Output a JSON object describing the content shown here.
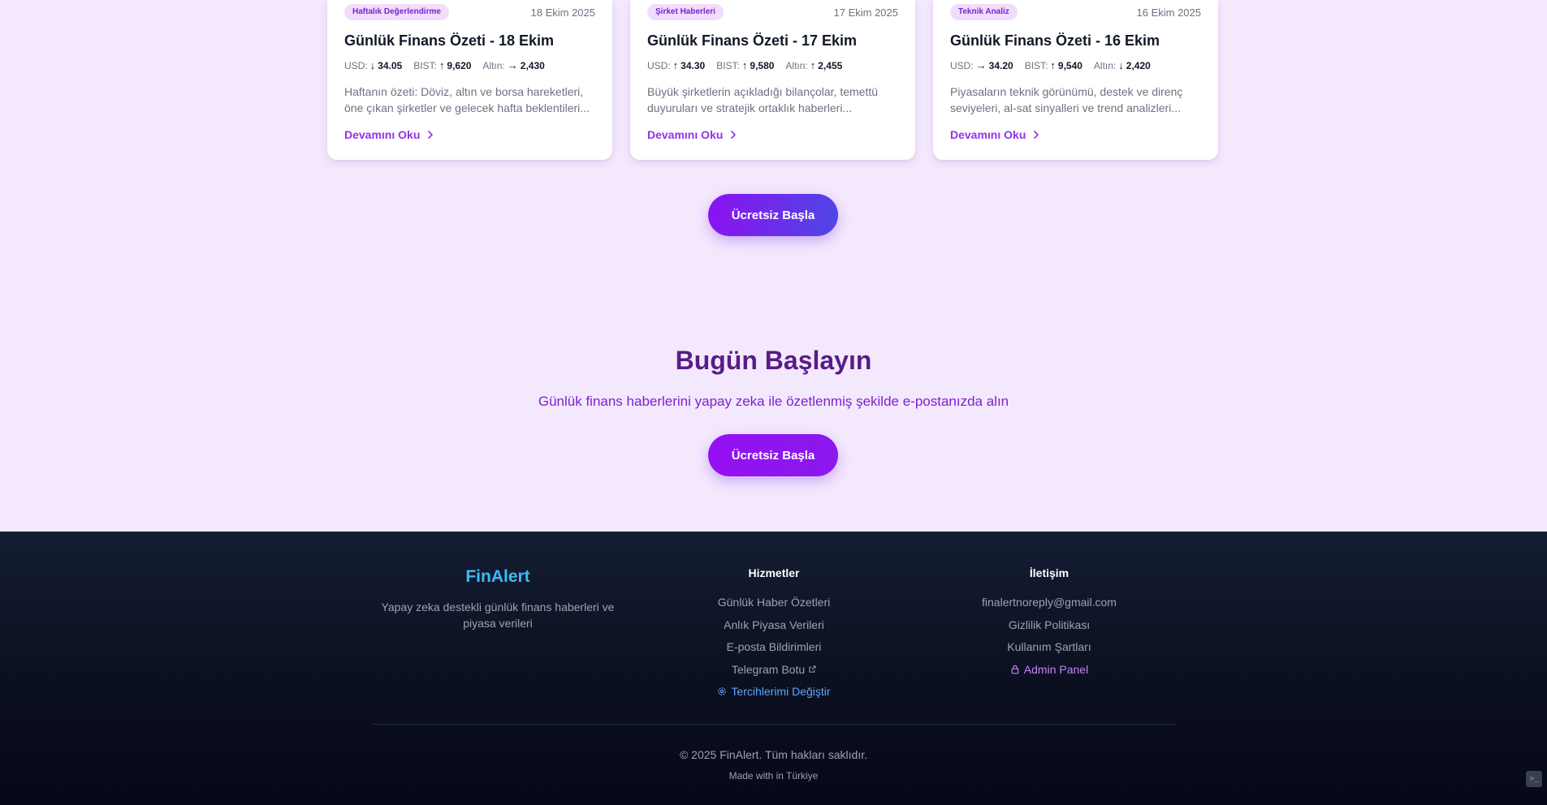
{
  "news_cards": [
    {
      "tag": "Haftalık Değerlendirme",
      "date": "18 Ekim 2025",
      "title": "Günlük Finans Özeti - 18 Ekim",
      "metrics": [
        {
          "label": "USD:",
          "arrow": "↓",
          "value": "34.05"
        },
        {
          "label": "BIST:",
          "arrow": "↑",
          "value": "9,620"
        },
        {
          "label": "Altın:",
          "arrow": "→",
          "value": "2,430"
        }
      ],
      "description": "Haftanın özeti: Döviz, altın ve borsa hareketleri, öne çıkan şirketler ve gelecek hafta beklentileri...",
      "link": "Devamını Oku"
    },
    {
      "tag": "Şirket Haberleri",
      "date": "17 Ekim 2025",
      "title": "Günlük Finans Özeti - 17 Ekim",
      "metrics": [
        {
          "label": "USD:",
          "arrow": "↑",
          "value": "34.30"
        },
        {
          "label": "BIST:",
          "arrow": "↑",
          "value": "9,580"
        },
        {
          "label": "Altın:",
          "arrow": "↑",
          "value": "2,455"
        }
      ],
      "description": "Büyük şirketlerin açıkladığı bilançolar, temettü duyuruları ve stratejik ortaklık haberleri...",
      "link": "Devamını Oku"
    },
    {
      "tag": "Teknik Analiz",
      "date": "16 Ekim 2025",
      "title": "Günlük Finans Özeti - 16 Ekim",
      "metrics": [
        {
          "label": "USD:",
          "arrow": "→",
          "value": "34.20"
        },
        {
          "label": "BIST:",
          "arrow": "↑",
          "value": "9,540"
        },
        {
          "label": "Altın:",
          "arrow": "↓",
          "value": "2,420"
        }
      ],
      "description": "Piyasaların teknik görünümü, destek ve direnç seviyeleri, al-sat sinyalleri ve trend analizleri...",
      "link": "Devamını Oku"
    }
  ],
  "cards_cta": {
    "label": "Ücretsiz Başla"
  },
  "cta": {
    "title": "Bugün Başlayın",
    "subtitle": "Günlük finans haberlerini yapay zeka ile özetlenmiş şekilde e-postanızda alın",
    "button": "Ücretsiz Başla"
  },
  "footer": {
    "brand": "FinAlert",
    "brand_desc": "Yapay zeka destekli günlük finans haberleri ve piyasa verileri",
    "services_heading": "Hizmetler",
    "services": [
      "Günlük Haber Özetleri",
      "Anlık Piyasa Verileri",
      "E-posta Bildirimleri",
      "Telegram Botu",
      "Tercihlerimi Değiştir"
    ],
    "contact_heading": "İletişim",
    "contact": [
      "finalertnoreply@gmail.com",
      "Gizlilik Politikası",
      "Kullanım Şartları",
      "Admin Panel"
    ],
    "copyright": "© 2025 FinAlert. Tüm hakları saklıdır.",
    "made_with": "Made with in Türkiye"
  },
  "colors": {
    "accent": "#9333ea",
    "page_bg": "#f4e8fd",
    "footer_bg": "#0b1020",
    "brand": "#38bdf8"
  },
  "icons": {
    "card_link": "chevron-right-icon",
    "telegram": "external-link-icon",
    "preferences": "gear-icon",
    "admin": "lock-icon"
  }
}
